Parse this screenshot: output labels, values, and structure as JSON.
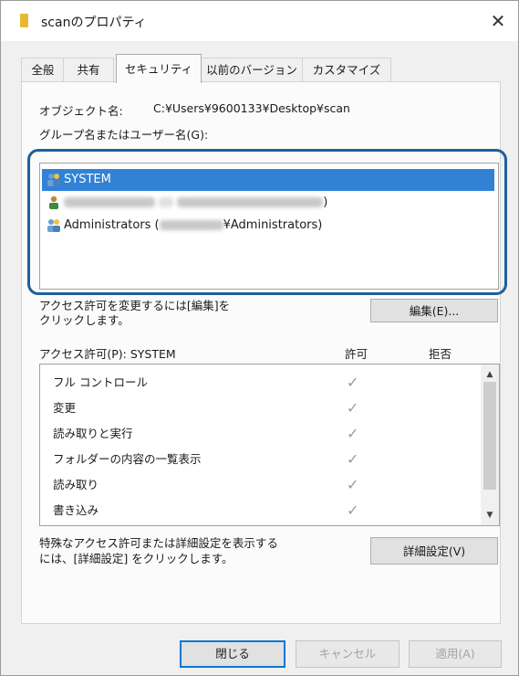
{
  "window": {
    "title": "scanのプロパティ",
    "close_glyph": "✕"
  },
  "tabs": [
    "全般",
    "共有",
    "セキュリティ",
    "以前のバージョン",
    "カスタマイズ"
  ],
  "active_tab": "セキュリティ",
  "object": {
    "label": "オブジェクト名:",
    "value": "C:¥Users¥9600133¥Desktop¥scan"
  },
  "group_label": "グループ名またはユーザー名(G):",
  "users": [
    {
      "name": "SYSTEM",
      "icon": "users-group-icon",
      "selected": true
    },
    {
      "name": "",
      "suffix": ")",
      "icon": "user-icon",
      "redacted": true
    },
    {
      "name": "Administrators (",
      "suffix": "¥Administrators)",
      "icon": "users-group-icon",
      "redacted_middle": true
    }
  ],
  "edit_hint": "アクセス許可を変更するには[編集]を\nクリックします。",
  "edit_button": "編集(E)...",
  "permissions_label": "アクセス許可(P): SYSTEM",
  "columns": {
    "allow": "許可",
    "deny": "拒否"
  },
  "permissions": [
    {
      "name": "フル コントロール",
      "allow": "✓"
    },
    {
      "name": "変更",
      "allow": "✓"
    },
    {
      "name": "読み取りと実行",
      "allow": "✓"
    },
    {
      "name": "フォルダーの内容の一覧表示",
      "allow": "✓"
    },
    {
      "name": "読み取り",
      "allow": "✓"
    },
    {
      "name": "書き込み",
      "allow": "✓"
    }
  ],
  "advanced_hint": "特殊なアクセス許可または詳細設定を表示する\nには、[詳細設定] をクリックします。",
  "advanced_button": "詳細設定(V)",
  "footer": {
    "close": "閉じる",
    "cancel": "キャンセル",
    "apply": "適用(A)"
  },
  "colors": {
    "selection": "#3182d6",
    "highlight_ring": "#1f5f9a",
    "focus_border": "#0078d7"
  }
}
